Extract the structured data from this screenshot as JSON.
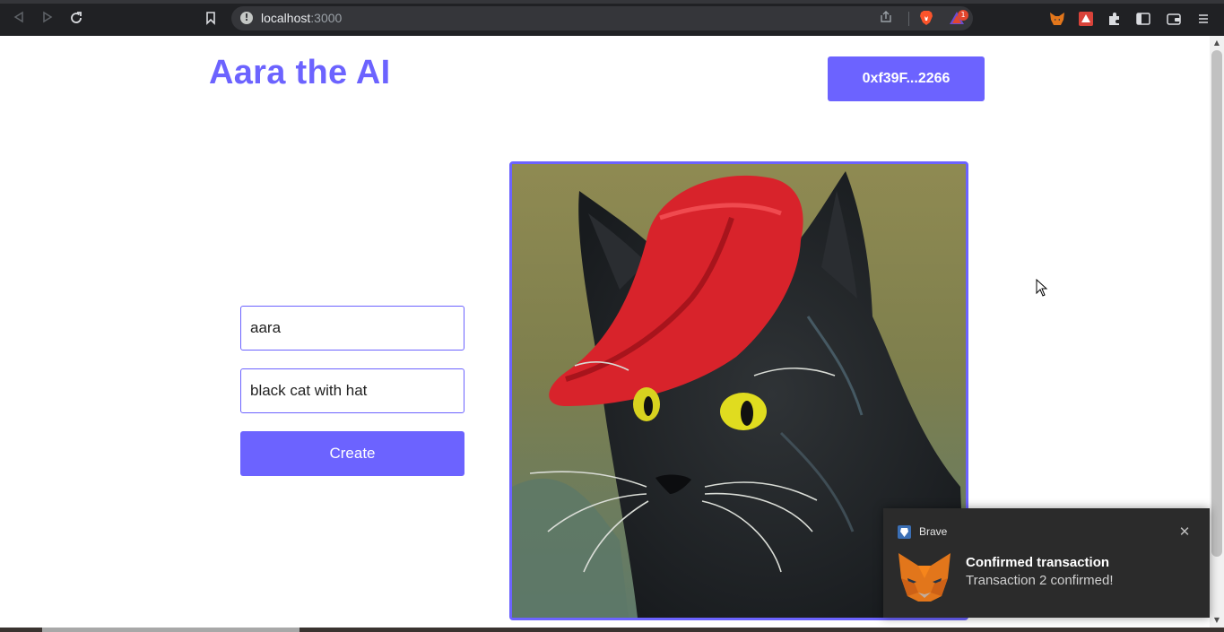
{
  "browser": {
    "url_host": "localhost",
    "url_port": ":3000",
    "rewards_badge": "1"
  },
  "header": {
    "title": "Aara the AI",
    "wallet_address": "0xf39F...2266"
  },
  "form": {
    "name_value": "aara",
    "prompt_value": "black cat with hat",
    "create_label": "Create"
  },
  "notification": {
    "app_name": "Brave",
    "title": "Confirmed transaction",
    "body": "Transaction 2 confirmed!"
  },
  "colors": {
    "accent": "#6c63ff",
    "chrome_bg": "#202124",
    "notification_bg": "#2b2b2b"
  },
  "icons": {
    "back": "back-arrow-icon",
    "forward": "forward-arrow-icon",
    "reload": "reload-icon",
    "bookmark": "bookmark-icon",
    "share": "share-icon",
    "brave_shields": "brave-lion-icon",
    "brave_rewards": "brave-rewards-icon",
    "metamask": "metamask-fox-icon",
    "extensions": "puzzle-icon",
    "sidebar": "sidebar-icon",
    "wallet": "wallet-icon",
    "menu": "hamburger-menu-icon",
    "close": "close-icon"
  }
}
